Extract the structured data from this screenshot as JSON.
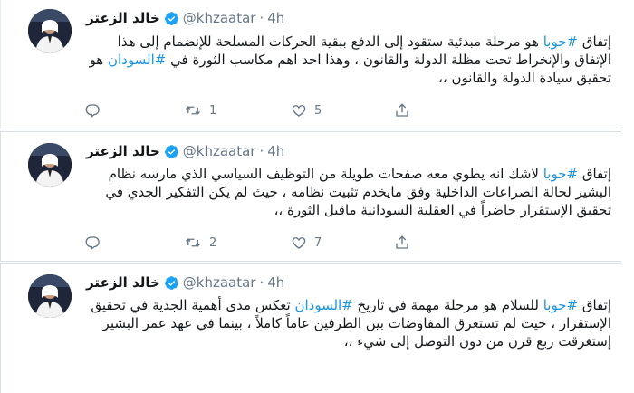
{
  "colors": {
    "hashtag": "#1b95e0",
    "verified": "#1da1f2",
    "meta_text": "#657786",
    "border": "#d9dee2"
  },
  "icons": {
    "verified": "verified-badge-icon",
    "reply": "reply-icon",
    "retweet": "retweet-icon",
    "like": "heart-icon",
    "share": "share-icon"
  },
  "tweets": [
    {
      "name": "خالد الزعتر",
      "handle": "@khzaatar",
      "separator": "·",
      "time": "4h",
      "segments": [
        {
          "text": "إتفاق ",
          "hashtag": false
        },
        {
          "text": "#جوبا",
          "hashtag": true
        },
        {
          "text": " هو مرحلة مبدئية ستقود إلى الدفع ببقية الحركات المسلحة للإنضمام إلى هذا الإتفاق والإنخراط تحت مظلة الدولة والقانون ، وهذا احد اهم مكاسب الثورة في ",
          "hashtag": false
        },
        {
          "text": "#السودان",
          "hashtag": true
        },
        {
          "text": " هو تحقيق سيادة الدولة والقانون ،،",
          "hashtag": false
        }
      ],
      "reply_count": "",
      "retweet_count": "1",
      "like_count": "5"
    },
    {
      "name": "خالد الزعتر",
      "handle": "@khzaatar",
      "separator": "·",
      "time": "4h",
      "segments": [
        {
          "text": "إتفاق ",
          "hashtag": false
        },
        {
          "text": "#جوبا",
          "hashtag": true
        },
        {
          "text": " لاشك انه يطوي معه صفحات طويلة من التوظيف السياسي الذي مارسه نظام البشير لحالة الصراعات الداخلية وفق مايخدم تثبيت نظامه ، حيث لم يكن التفكير الجدي في تحقيق الإستقرار حاضراً في العقلية السودانية ماقبل الثورة ،،",
          "hashtag": false
        }
      ],
      "reply_count": "",
      "retweet_count": "2",
      "like_count": "7"
    },
    {
      "name": "خالد الزعتر",
      "handle": "@khzaatar",
      "separator": "·",
      "time": "4h",
      "segments": [
        {
          "text": "إتفاق ",
          "hashtag": false
        },
        {
          "text": "#جوبا",
          "hashtag": true
        },
        {
          "text": " للسلام هو مرحلة مهمة في تاريخ ",
          "hashtag": false
        },
        {
          "text": "#السودان",
          "hashtag": true
        },
        {
          "text": " تعكس مدى أهمية الجدية في تحقيق الإستقرار ، حيث لم تستغرق المفاوضات بين الطرفين عاماً كاملاً ، بينما في عهد عمر البشير إستغرقت ربع قرن من دون التوصل إلى شيء ،،",
          "hashtag": false
        }
      ],
      "reply_count": "",
      "retweet_count": "",
      "like_count": ""
    }
  ]
}
